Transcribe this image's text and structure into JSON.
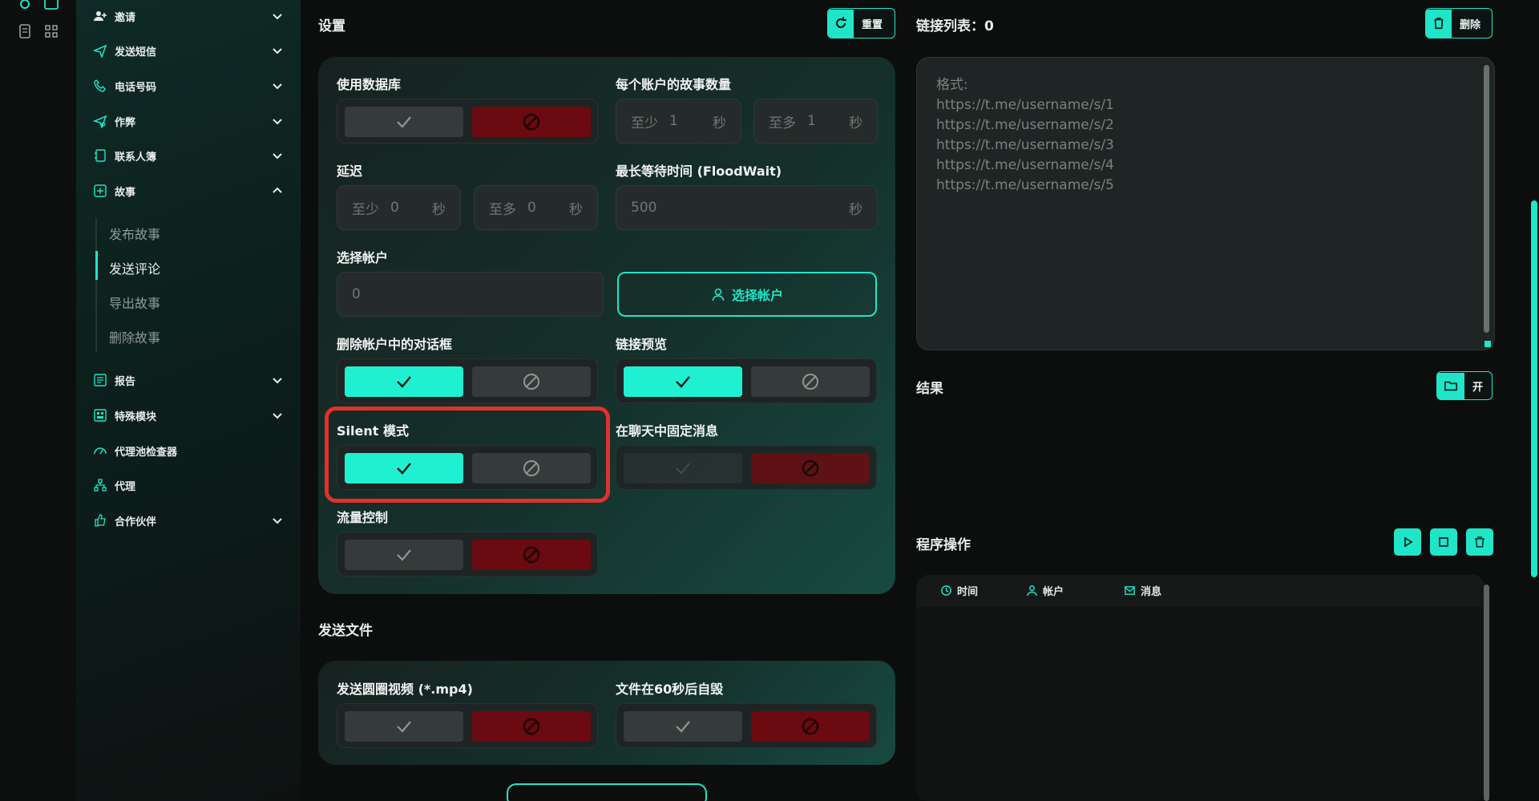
{
  "sidebar": {
    "items": [
      {
        "label": "邀请",
        "icon": "user-plus-icon"
      },
      {
        "label": "发送短信",
        "icon": "send-icon"
      },
      {
        "label": "电话号码",
        "icon": "phone-icon"
      },
      {
        "label": "作弊",
        "icon": "send-gear-icon"
      },
      {
        "label": "联系人簿",
        "icon": "contacts-book-icon"
      },
      {
        "label": "故事",
        "icon": "plus-square-icon"
      },
      {
        "label": "报告",
        "icon": "report-icon"
      },
      {
        "label": "特殊模块",
        "icon": "module-icon"
      },
      {
        "label": "代理池检查器",
        "icon": "gauge-icon"
      },
      {
        "label": "代理",
        "icon": "network-icon"
      },
      {
        "label": "合作伙伴",
        "icon": "thumb-up-icon"
      }
    ],
    "story_sub": [
      "发布故事",
      "发送评论",
      "导出故事",
      "删除故事"
    ],
    "active_sub": "发送评论"
  },
  "settings": {
    "title": "设置",
    "reset_label": "重置",
    "use_db_label": "使用数据库",
    "stories_per_account_label": "每个账户的故事数量",
    "min_prefix": "至少",
    "max_prefix": "至多",
    "stories_min": "1",
    "stories_max": "1",
    "unit_sec": "秒",
    "delay_label": "延迟",
    "delay_min": "0",
    "delay_max": "0",
    "floodwait_label": "最长等待时间 (FloodWait)",
    "floodwait_value": "500",
    "select_account_label": "选择帐户",
    "accounts_count": "0",
    "select_account_button": "选择帐户",
    "delete_dialogs_label": "删除帐户中的对话框",
    "link_preview_label": "链接预览",
    "silent_label": "Silent 模式",
    "pin_label": "在聊天中固定消息",
    "flow_label": "流量控制"
  },
  "send_files": {
    "title": "发送文件",
    "round_video_label": "发送圆圈视频 (*.mp4)",
    "self_destruct_label": "文件在60秒后自毁"
  },
  "links": {
    "title": "链接列表：0",
    "delete_label": "删除",
    "placeholder_lines": [
      "格式:",
      "https://t.me/username/s/1",
      "https://t.me/username/s/2",
      "https://t.me/username/s/3",
      "https://t.me/username/s/4",
      "https://t.me/username/s/5"
    ]
  },
  "results": {
    "title": "结果",
    "open_label": "开"
  },
  "ops": {
    "title": "程序操作",
    "col_time": "时间",
    "col_account": "帐户",
    "col_message": "消息"
  },
  "colors": {
    "accent": "#1fe6c8",
    "danger": "#6b0a10",
    "highlight": "#e0312d"
  }
}
